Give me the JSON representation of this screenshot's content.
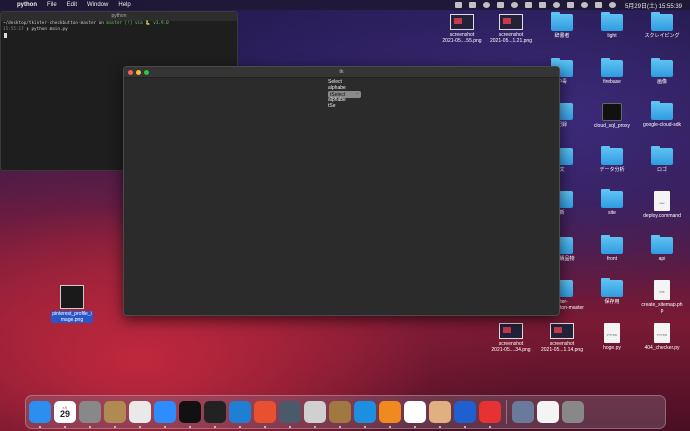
{
  "menubar": {
    "app_name": "python",
    "items": [
      "File",
      "Edit",
      "Window",
      "Help"
    ],
    "clock": "5月29日(土) 15:55:39"
  },
  "terminal": {
    "title": "python",
    "prompt_path": "~/desktop/tkinter-checkbutton-master on",
    "prompt_branch": " master [!] via 🐍 v3.9.0",
    "time": "15:55:17",
    "command": "❯ python main.py"
  },
  "tk_window": {
    "title": "tk",
    "lines": [
      "Select",
      "alphabe"
    ],
    "optionmenu_value": "tSelect",
    "lines_after": [
      "alphabe",
      "tSe"
    ]
  },
  "desktop": {
    "icons": [
      {
        "name": "screenshot-1",
        "label": "screenshot\n2021-05....55.png",
        "kind": "thumb"
      },
      {
        "name": "screenshot-2",
        "label": "screenshot\n2021-05...1.21.png",
        "kind": "thumb"
      },
      {
        "name": "folder-jisho",
        "label": "辞書者",
        "kind": "folder"
      },
      {
        "name": "folder-light",
        "label": "light",
        "kind": "folder"
      },
      {
        "name": "folder-scraping",
        "label": "スクレイピング",
        "kind": "folder"
      },
      {
        "name": "folder-chuka",
        "label": "中毒",
        "kind": "folder"
      },
      {
        "name": "folder-firebase",
        "label": "firebase",
        "kind": "folder"
      },
      {
        "name": "folder-gazou",
        "label": "画像",
        "kind": "folder"
      },
      {
        "name": "app-cloud-sql-proxy",
        "label": "cloud_sql_proxy",
        "kind": "darkapp"
      },
      {
        "name": "folder-google-cloud-sdk",
        "label": "google-cloud-sdk",
        "kind": "folder"
      },
      {
        "name": "folder-kiroku",
        "label": "記録",
        "kind": "folder"
      },
      {
        "name": "folder-data-bunseki",
        "label": "データ分析",
        "kind": "folder"
      },
      {
        "name": "folder-logo",
        "label": "ロゴ",
        "kind": "folder"
      },
      {
        "name": "folder-bun",
        "label": "文",
        "kind": "folder"
      },
      {
        "name": "folder-site",
        "label": "site",
        "kind": "folder"
      },
      {
        "name": "file-deploy-command",
        "label": "deploy.command",
        "kind": "doc",
        "tag": "exec"
      },
      {
        "name": "folder-mu",
        "label": "新",
        "kind": "folder"
      },
      {
        "name": "folder-front",
        "label": "front",
        "kind": "folder"
      },
      {
        "name": "folder-api",
        "label": "api",
        "kind": "folder"
      },
      {
        "name": "folder-seiseki",
        "label": "式成績品物",
        "kind": "folder"
      },
      {
        "name": "file-create-sitemap",
        "label": "create_sitemap.ph\np",
        "kind": "doc",
        "tag": "PHP"
      },
      {
        "name": "folder-hozonyou",
        "label": "保存用",
        "kind": "folder"
      },
      {
        "name": "file-pinterest",
        "label": "pinterest_profile_i\nmage.png",
        "kind": "ig"
      },
      {
        "name": "file-hoge-py",
        "label": "hoge.py",
        "kind": "doc",
        "tag": "PYTHON"
      },
      {
        "name": "file-404-checker",
        "label": "404_checker.py",
        "kind": "doc",
        "tag": "PYTHON"
      },
      {
        "name": "screenshot-3",
        "label": "screenshot\n2021-05....34.png",
        "kind": "thumb"
      },
      {
        "name": "screenshot-4",
        "label": "screenshot\n2021-05...1.14.png",
        "kind": "thumb"
      },
      {
        "name": "folder-partial-1",
        "label": "2021-05....26.png",
        "kind": "partial"
      },
      {
        "name": "folder-partial-2",
        "label": "inter-\ncheckbutton-master",
        "kind": "partial"
      }
    ]
  },
  "dock": {
    "date_day": "29",
    "date_month": "5月",
    "apps": [
      {
        "name": "finder",
        "color": "#2a8ff0"
      },
      {
        "name": "calendar",
        "color": "#ffffff"
      },
      {
        "name": "system-preferences",
        "color": "#888888"
      },
      {
        "name": "archive",
        "color": "#b08a50"
      },
      {
        "name": "chrome",
        "color": "#e9e9e9"
      },
      {
        "name": "zoom",
        "color": "#2d8cff"
      },
      {
        "name": "terminal-green",
        "color": "#111111"
      },
      {
        "name": "terminal",
        "color": "#222222"
      },
      {
        "name": "vscode",
        "color": "#1f7fd4"
      },
      {
        "name": "safari",
        "color": "#e85030"
      },
      {
        "name": "quicktime",
        "color": "#4a5a6a"
      },
      {
        "name": "sequel",
        "color": "#d0d0d0"
      },
      {
        "name": "keka",
        "color": "#a07840"
      },
      {
        "name": "docker",
        "color": "#1d8fe0"
      },
      {
        "name": "sourcetree",
        "color": "#f08a20"
      },
      {
        "name": "smartgit",
        "color": "#ffffff"
      },
      {
        "name": "preview",
        "color": "#e0b080"
      },
      {
        "name": "infinity",
        "color": "#1f5fcf"
      },
      {
        "name": "clock",
        "color": "#e63232"
      },
      {
        "name": "downloads",
        "color": "#6a7a9a"
      },
      {
        "name": "document",
        "color": "#f4f4f4"
      },
      {
        "name": "trash",
        "color": "#888888"
      }
    ]
  }
}
